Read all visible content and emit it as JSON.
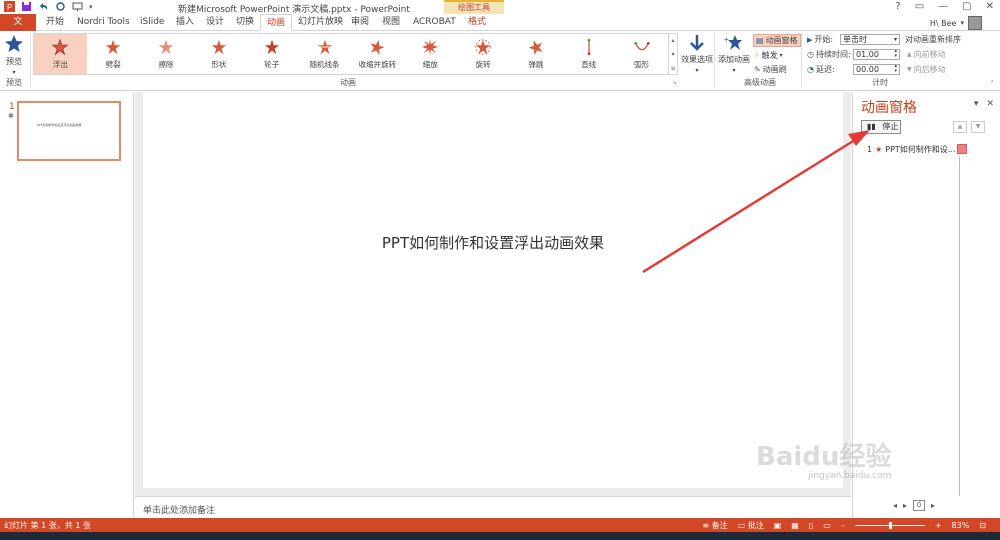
{
  "window": {
    "title": "新建Microsoft PowerPoint 演示文稿.pptx - PowerPoint",
    "context_group": "绘图工具",
    "controls": [
      "?",
      "▭",
      "—",
      "▢",
      "✕"
    ]
  },
  "tabs": [
    {
      "label": "文件"
    },
    {
      "label": "开始"
    },
    {
      "label": "Nordri Tools"
    },
    {
      "label": "iSlide"
    },
    {
      "label": "插入"
    },
    {
      "label": "设计"
    },
    {
      "label": "切换"
    },
    {
      "label": "动画"
    },
    {
      "label": "幻灯片放映"
    },
    {
      "label": "审阅"
    },
    {
      "label": "视图"
    },
    {
      "label": "ACROBAT"
    },
    {
      "label": "格式"
    }
  ],
  "account": {
    "name": "H\\ Bee"
  },
  "ribbon": {
    "preview": {
      "label": "预览",
      "group": "预览"
    },
    "gallery": {
      "group": "动画",
      "items": [
        "浮出",
        "劈裂",
        "擦除",
        "形状",
        "轮子",
        "随机线条",
        "收缩并旋转",
        "缩放",
        "旋转",
        "弹跳",
        "直线",
        "弧形"
      ]
    },
    "effect_options": "效果选项",
    "advanced": {
      "add_animation": "添加动画",
      "pane": "动画窗格",
      "trigger": "触发",
      "painter": "动画刷",
      "group": "高级动画"
    },
    "timing": {
      "start_label": "开始:",
      "start_value": "单击时",
      "duration_label": "持续时间:",
      "duration_value": "01.00",
      "delay_label": "延迟:",
      "delay_value": "00.00",
      "reorder": "对动画重新排序",
      "move_earlier": "向前移动",
      "move_later": "向后移动",
      "group": "计时"
    }
  },
  "thumbnails": {
    "number": "1",
    "star": "✱",
    "text": "PPT如何制作和设置浮出动画效果"
  },
  "slide": {
    "title": "PPT如何制作和设置浮出动画效果"
  },
  "notes": {
    "placeholder": "单击此处添加备注"
  },
  "anim_pane": {
    "title": "动画窗格",
    "stop": "停止",
    "items": [
      {
        "index": "1",
        "label": "PPT如何制作和设..."
      }
    ],
    "footer_value": "0"
  },
  "statusbar": {
    "left": "幻灯片 第 1 张，共 1 张",
    "notes": "备注",
    "comments": "批注",
    "zoom": "83%"
  },
  "watermark": {
    "text": "Baidu经验",
    "sub": "jingyan.baidu.com"
  },
  "colors": {
    "accent": "#d24726",
    "pane_title": "#c43e1c",
    "arrow": "#e53935"
  }
}
